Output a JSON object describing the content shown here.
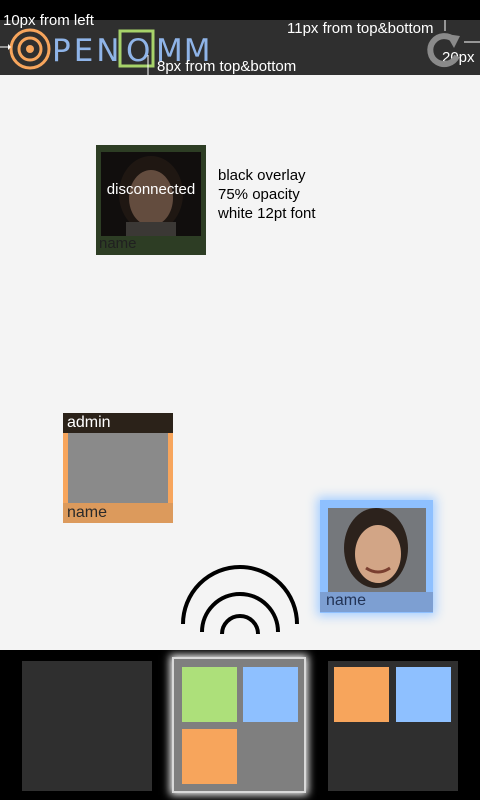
{
  "app": {
    "logo_text": "OPENCOMM"
  },
  "annotations": {
    "left_margin": "10px from left",
    "right_spacing": "11px from top&bottom",
    "logo_spacing": "8px from top&bottom",
    "right_margin": "20px",
    "overlay_note": [
      "black overlay",
      "75% opacity",
      "white 12pt font"
    ]
  },
  "contacts": [
    {
      "name": "name",
      "status": "disconnected",
      "style": "disconnected"
    },
    {
      "name": "name",
      "role": "admin",
      "style": "admin"
    },
    {
      "name": "name",
      "style": "selected"
    }
  ],
  "colors": {
    "header": "#2f2f2f",
    "canvas": "#f4f4f4",
    "accent_orange": "#f7a55c",
    "accent_blue": "#8ec0ff",
    "accent_green": "#ade07a",
    "page_selected": "#7f7f7f"
  },
  "pages": [
    {
      "tiles": []
    },
    {
      "tiles": [
        "green",
        "blue",
        "orange"
      ],
      "selected": true
    },
    {
      "tiles": [
        "orange",
        "blue"
      ]
    }
  ]
}
